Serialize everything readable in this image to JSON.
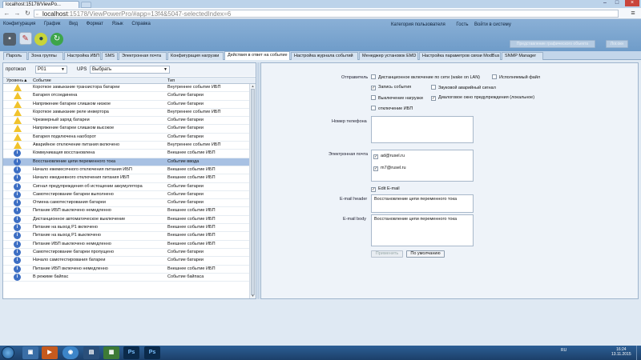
{
  "browser": {
    "tab_title": "localhost:15178/ViewPo...",
    "url_host": "localhost",
    "url_rest": ":15178/ViewPowerPro/#app=13f4&5047-selectedIndex=6"
  },
  "menu": [
    "Конфигурация",
    "График",
    "Вид",
    "Формат",
    "Язык",
    "Справка"
  ],
  "user": {
    "category_label": "Категория пользователя",
    "category_value": "Гость",
    "logout": "Войти в систему"
  },
  "header_buttons": {
    "wide": "Представление графического объекта",
    "narrow": "Лог.окн"
  },
  "tabs": [
    "Пароль",
    "Зона группы",
    "Настройка ИБП",
    "SMS",
    "Электронная почта",
    "Конфигурация нагрузки",
    "Действия в ответ на событие",
    "Настройка журнала событий",
    "Менеджер установок EMD",
    "Настройка параметров связи ModBus",
    "SNMP Manager"
  ],
  "filter": {
    "protocol_label": "протокол",
    "protocol_value": "P01",
    "ups_label": "UPS",
    "ups_value": "Выбрать"
  },
  "table": {
    "col_level": "Уровень▲",
    "col_event": "Событие",
    "col_type": "Тип",
    "rows": [
      {
        "icon": "warning",
        "event": "Короткое замыкание транзистора батареи",
        "type": "Внутреннее событие ИБП"
      },
      {
        "icon": "warning",
        "event": "Батарея отсоединена",
        "type": "Событие батареи"
      },
      {
        "icon": "warning",
        "event": "Напряжение батареи слишком низкое",
        "type": "Событие батареи"
      },
      {
        "icon": "warning",
        "event": "Короткое замыкание реле инвертора",
        "type": "Внутреннее событие ИБП"
      },
      {
        "icon": "warning",
        "event": "Чрезмерный заряд батареи",
        "type": "Событие батареи"
      },
      {
        "icon": "warning",
        "event": "Напряжение батареи слишком высокое",
        "type": "Событие батареи"
      },
      {
        "icon": "warning",
        "event": "Батарея подключена наоборот",
        "type": "Событие батареи"
      },
      {
        "icon": "warning",
        "event": "Аварийное отключение питания включено",
        "type": "Внутреннее событие ИБП"
      },
      {
        "icon": "info",
        "event": "Коммуникация восстановлена",
        "type": "Внешнее событие ИБП"
      },
      {
        "icon": "info",
        "event": "Восстановление цепи переменного тока",
        "type": "Событие ввода",
        "selected": true
      },
      {
        "icon": "info",
        "event": "Начало ежемесячного отключения питания ИБП",
        "type": "Внешнее событие ИБП"
      },
      {
        "icon": "info",
        "event": "Начало ежедневного отключения питания ИБП",
        "type": "Внешнее событие ИБП"
      },
      {
        "icon": "info",
        "event": "Сигнал предупреждения об истощении аккумулятора",
        "type": "Событие батареи"
      },
      {
        "icon": "info",
        "event": "Самотестирование батареи выполнено",
        "type": "Событие батареи"
      },
      {
        "icon": "info",
        "event": "Отмена самотестирования батареи",
        "type": "Событие батареи"
      },
      {
        "icon": "info",
        "event": "Питание ИБП выключено немедленно",
        "type": "Внешнее событие ИБП"
      },
      {
        "icon": "info",
        "event": "Дистанционное автоматическое выключение",
        "type": "Внешнее событие ИБП"
      },
      {
        "icon": "info",
        "event": "Питание на выход P1 включено",
        "type": "Внешнее событие ИБП"
      },
      {
        "icon": "info",
        "event": "Питание на выход P1 выключено",
        "type": "Внешнее событие ИБП"
      },
      {
        "icon": "info",
        "event": "Питание ИБП выключено немедленно",
        "type": "Внешнее событие ИБП"
      },
      {
        "icon": "info",
        "event": "Самотестирование батареи пропущено",
        "type": "Событие батареи"
      },
      {
        "icon": "info",
        "event": "Начало самотестирования батареи",
        "type": "Событие батареи"
      },
      {
        "icon": "info",
        "event": "Питание ИБП включено немедленно",
        "type": "Внешнее событие ИБП"
      },
      {
        "icon": "info",
        "event": "В режиме байпас",
        "type": "Событие байпаса"
      }
    ]
  },
  "actions": {
    "sender_label": "Отправитель",
    "remote_on": "Дистанционное включение по сети (wake on LAN)",
    "exec_file": "Исполняемый файл",
    "log_event": "Запись события",
    "sound_alarm": "Звуковой аварийный сигнал",
    "load_off": "Выключение нагрузки",
    "dialog_warning": "Диалоговое окно предупреждения (локальное)",
    "ups_off": "отключение ИБП",
    "phone_label": "Номер телефона",
    "email_label": "Электронная почта",
    "emails": [
      "ad@rusel.ru",
      "m7@rusel.ru"
    ],
    "edit_email": "Edit E-mail",
    "header_label": "E-mail header",
    "header_value": "Восстановление цепи переменного тока",
    "body_label": "E-mail body",
    "body_value": "Восстановление цепи переменного тока",
    "apply": "Применить",
    "default": "По умолчанию"
  },
  "taskbar": {
    "lang": "RU",
    "time": "16:24",
    "date": "13.11.2015"
  },
  "colors": {
    "selected_row": "#a8c1e3",
    "header_bg": "#7fa7d0",
    "warning": "#f1c32c",
    "info": "#3d6fc4"
  }
}
